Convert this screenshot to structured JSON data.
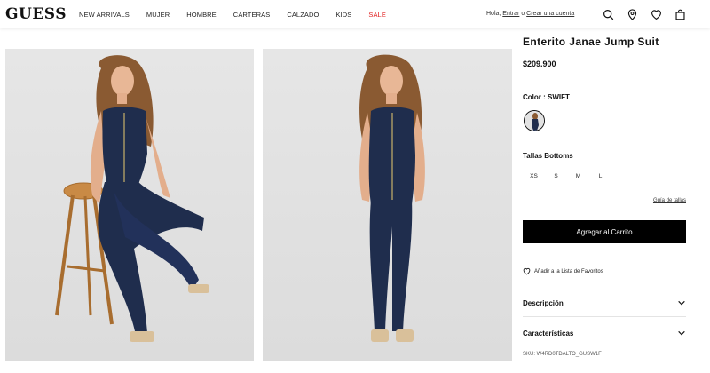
{
  "brand": {
    "logo": "GUESS"
  },
  "nav": {
    "items": [
      {
        "label": "NEW ARRIVALS"
      },
      {
        "label": "MUJER"
      },
      {
        "label": "HOMBRE"
      },
      {
        "label": "CARTERAS"
      },
      {
        "label": "CALZADO"
      },
      {
        "label": "KIDS"
      },
      {
        "label": "SALE"
      }
    ]
  },
  "account": {
    "greeting": "Hola,",
    "login": "Entrar",
    "or": "o",
    "register": "Crear una cuenta"
  },
  "header_icons": [
    "search-icon",
    "location-icon",
    "heart-icon",
    "bag-icon"
  ],
  "product": {
    "title": "Enterito Janae Jump Suit",
    "price": "$209.900",
    "color_label": "Color : SWIFT",
    "sizes_label": "Tallas Bottoms",
    "sizes": [
      "XS",
      "S",
      "M",
      "L"
    ],
    "size_guide": "Guía de tallas",
    "add_to_cart": "Agregar al Carrito",
    "add_to_favorites": "Añadir a la Lista de Favoritos",
    "description_label": "Descripción",
    "features_label": "Características",
    "sku": "SKU:  W4RD0TDALTO_GUSW1F"
  },
  "colors": {
    "sale": "#e02020",
    "cart_button": "#000000",
    "denim": "#1f2d4d",
    "background": "#ffffff"
  }
}
